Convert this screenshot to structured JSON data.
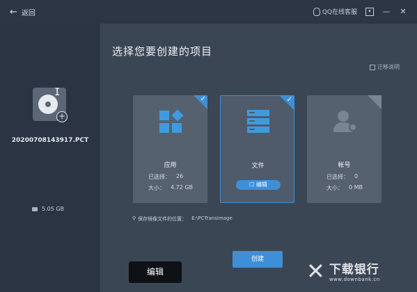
{
  "titlebar": {
    "back_label": "返回",
    "qq_label": "QQ在线客服",
    "menu_icon": "menu-box-icon",
    "minimize_icon": "minimize-icon",
    "close_icon": "close-icon"
  },
  "left": {
    "filename": "20200708143917.PCT",
    "disk_size": "5.05 GB"
  },
  "main": {
    "heading": "选择您要创建的项目",
    "migrate_label": "迁移说明",
    "cards": [
      {
        "label": "应用",
        "selected_label": "已选择：",
        "selected_value": "26",
        "size_label": "大小：",
        "size_value": "4.72 GB",
        "checked": true
      },
      {
        "label": "文件",
        "edit_label": "编辑",
        "checked": true
      },
      {
        "label": "帐号",
        "selected_label": "已选择：",
        "selected_value": "0",
        "size_label": "大小：",
        "size_value": "0 MB",
        "checked": false
      }
    ],
    "save_location_label": "保存镜像文件的位置：",
    "save_location_value": "E:\\PCTransImage",
    "create_label": "创建"
  },
  "overlay": {
    "edit_label": "编辑",
    "watermark_title": "下载银行",
    "watermark_url": "www.downbank.cn"
  },
  "colors": {
    "accent": "#3f8fd6",
    "panel": "#3b4655",
    "sidebar": "#2a3442",
    "card": "#56616f"
  }
}
